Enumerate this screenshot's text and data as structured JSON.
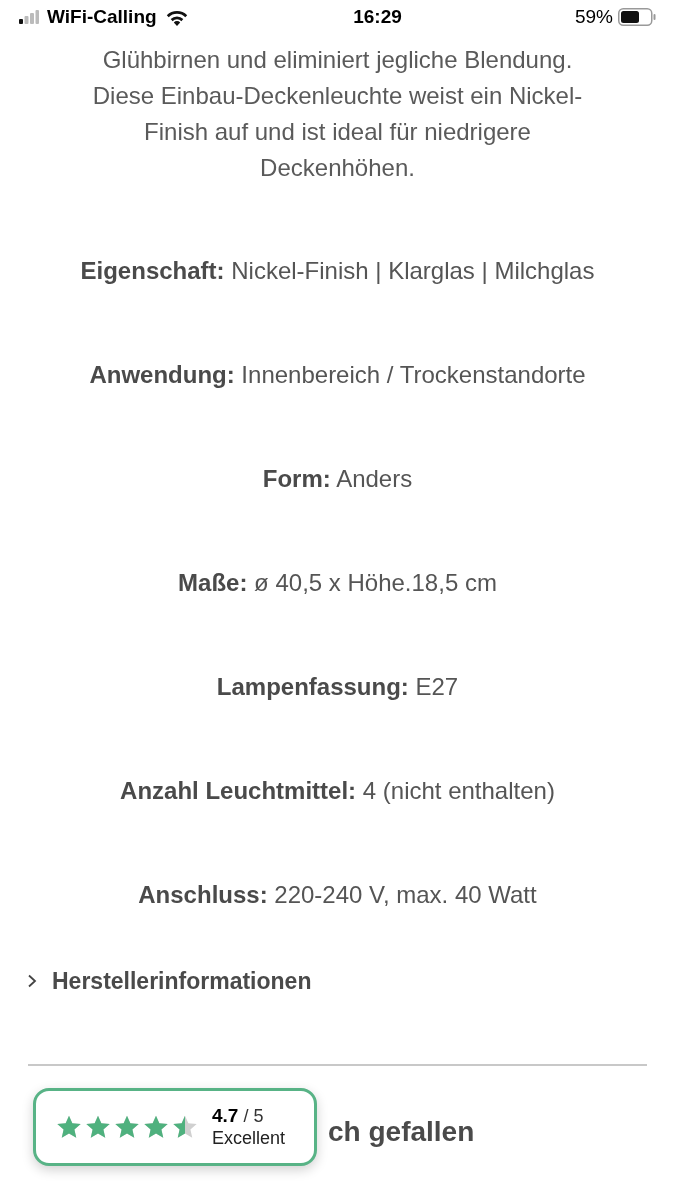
{
  "status_bar": {
    "carrier": "WiFi-Calling",
    "time": "16:29",
    "battery": "59%"
  },
  "description": "Glühbirnen und eliminiert jegliche Blendung. Diese Einbau-Deckenleuchte weist ein Nickel-Finish auf und ist ideal für niedrigere Deckenhöhen.",
  "specs": [
    "**Eigenschaft:** Nickel-Finish | Klarglas | Milchglas",
    "**Anwendung:** Innenbereich / Trockenstandorte",
    "**Form:** Anders",
    "**Maße:** ø 40,5 x Höhe.18,5 cm",
    "**Lampenfassung:** E27",
    "**Anzahl Leuchtmittel:** 4 (nicht enthalten)",
    "**Anschluss:** 220-240 V, max. 40 Watt"
  ],
  "accordion": {
    "label": "Herstellerinformationen",
    "expanded": false
  },
  "section_heading": "ch gefallen",
  "rating_badge": {
    "stars": 4.5,
    "score": "4.7",
    "scale": "/ 5",
    "label": "Excellent"
  }
}
